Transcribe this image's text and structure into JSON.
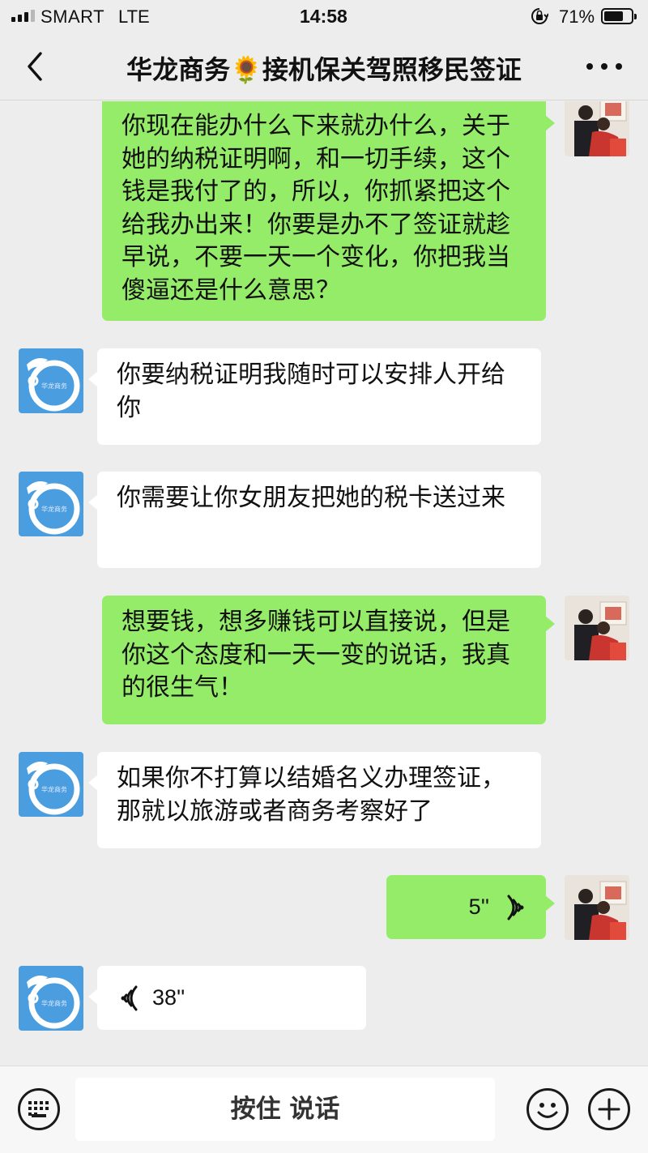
{
  "status_bar": {
    "carrier": "SMART",
    "network": "LTE",
    "time": "14:58",
    "battery_percent": "71%",
    "battery_level": 0.71
  },
  "nav": {
    "title": "华龙商务🌻接机保关驾照移民签证",
    "back_icon": "chevron-left-icon",
    "more_icon": "more-dots-icon"
  },
  "colors": {
    "my_bubble": "#95ec69",
    "their_bubble": "#ffffff",
    "background": "#ededed",
    "contact_avatar": "#4a9ee0"
  },
  "messages": [
    {
      "sender": "me",
      "text": "你现在能办什么下来就办什么，关于她的纳税证明啊，和一切手续，这个钱是我付了的，所以，你抓紧把这个给我办出来！你要是办不了签证就趁早说，不要一天一个变化，你把我当傻逼还是什么意思？"
    },
    {
      "sender": "contact",
      "text": "你要纳税证明我随时可以安排人开给你"
    },
    {
      "sender": "contact",
      "text": "你需要让你女朋友把她的税卡送过来"
    },
    {
      "sender": "me",
      "text": "想要钱，想多赚钱可以直接说，但是你这个态度和一天一变的说话，我真的很生气！"
    },
    {
      "sender": "contact",
      "text": "如果你不打算以结婚名义办理签证，那就以旅游或者商务考察好了"
    },
    {
      "sender": "me",
      "type": "voice",
      "duration": "5''"
    },
    {
      "sender": "contact",
      "type": "voice",
      "duration": "38''"
    }
  ],
  "contact_avatar_text": "华龙商务",
  "input_bar": {
    "hold_to_talk": "按住 说话",
    "keyboard_icon": "keyboard-icon",
    "emoji_icon": "emoji-icon",
    "plus_icon": "plus-icon"
  }
}
